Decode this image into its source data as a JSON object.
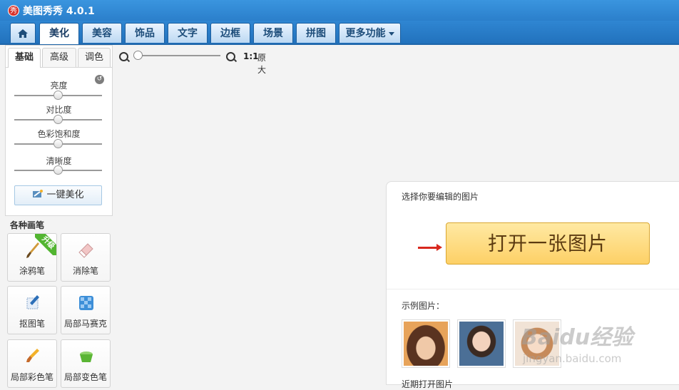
{
  "app": {
    "title": "美图秀秀 4.0.1",
    "logo_text": "秀"
  },
  "tabs": [
    "美化",
    "美容",
    "饰品",
    "文字",
    "边框",
    "场景",
    "拼图",
    "更多功能"
  ],
  "sub_tabs": [
    "基础",
    "高级",
    "调色"
  ],
  "adjustments": [
    {
      "label": "亮度",
      "value": 0.5
    },
    {
      "label": "对比度",
      "value": 0.5
    },
    {
      "label": "色彩饱和度",
      "value": 0.5
    },
    {
      "label": "清晰度",
      "value": 0.5
    }
  ],
  "one_click_label": "一键美化",
  "brushes_title": "各种画笔",
  "brushes": [
    {
      "label": "涂鸦笔",
      "badge": "升级",
      "icon": "paintbrush-icon"
    },
    {
      "label": "消除笔",
      "icon": "eraser-icon"
    },
    {
      "label": "抠图笔",
      "icon": "pen-icon"
    },
    {
      "label": "局部马赛克",
      "icon": "mosaic-icon"
    },
    {
      "label": "局部彩色笔",
      "icon": "color-brush-icon"
    },
    {
      "label": "局部变色笔",
      "icon": "bucket-icon"
    }
  ],
  "zoom": {
    "ratio_label": "1:1",
    "original_label": "原大",
    "level": 0.0
  },
  "open_panel": {
    "title": "选择你要编辑的图片",
    "open_button": "打开一张图片",
    "samples_label": "示例图片：",
    "recent_label": "近期打开图片"
  },
  "watermark": {
    "main": "Baidu经验",
    "sub": "jingyan.baidu.com"
  },
  "colors": {
    "titlebar": "#2b7fcb",
    "accent_button": "#fdd066",
    "arrow": "#d8281e",
    "badge": "#52b531"
  }
}
